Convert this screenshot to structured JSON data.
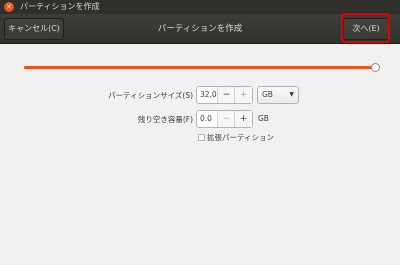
{
  "window": {
    "title": "パーティションを作成"
  },
  "header": {
    "title": "パーティションを作成",
    "cancel_label": "キャンセル(C)",
    "next_label": "次へ(E)"
  },
  "slider": {
    "value_fraction": 0.98,
    "accent": "#e95420"
  },
  "form": {
    "size_label": "パーティションサイズ(S)",
    "size_value": "32.0",
    "size_minus": "−",
    "size_plus": "+",
    "unit_select": "GB",
    "free_label": "残り空き容量(F)",
    "free_value": "0.0",
    "free_minus": "−",
    "free_plus": "+",
    "free_unit": "GB",
    "extended_label": "拡張パーティション",
    "extended_checked": false
  }
}
